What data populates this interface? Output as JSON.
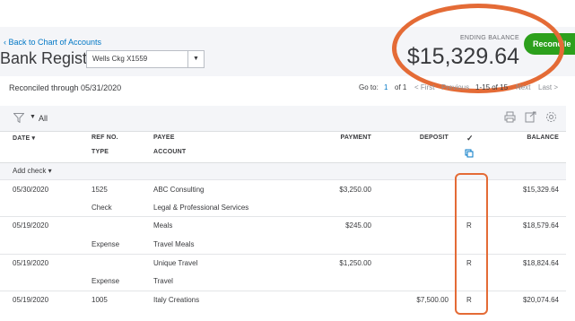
{
  "header": {
    "back_link": "Back to Chart of Accounts",
    "title": "Bank Register",
    "account_value": "Wells Ckg X1559",
    "ending_balance_label": "ENDING BALANCE",
    "ending_balance_value": "$15,329.64",
    "reconcile_label": "Reconcile"
  },
  "status": {
    "reconciled_through": "Reconciled through 05/31/2020"
  },
  "pager": {
    "go_to": "Go to:",
    "page": "1",
    "of": "of 1",
    "first": "< First",
    "previous": "Previous",
    "range": "1-15 of 15",
    "next": "Next",
    "last": "Last >"
  },
  "filter": {
    "label": "All"
  },
  "columns": {
    "date": "DATE ▾",
    "ref_no": "REF NO.",
    "type": "TYPE",
    "payee": "PAYEE",
    "account": "ACCOUNT",
    "payment": "PAYMENT",
    "deposit": "DEPOSIT",
    "check": "✓",
    "balance": "BALANCE"
  },
  "add_check": "Add check ▾",
  "rows": [
    {
      "date": "05/30/2020",
      "ref": "1525",
      "type": "Check",
      "payee": "ABC Consulting",
      "account": "Legal & Professional Services",
      "payment": "$3,250.00",
      "deposit": "",
      "status": "",
      "balance": "$15,329.64"
    },
    {
      "date": "05/19/2020",
      "ref": "",
      "type": "Expense",
      "payee": "Meals",
      "account": "Travel Meals",
      "payment": "$245.00",
      "deposit": "",
      "status": "R",
      "balance": "$18,579.64"
    },
    {
      "date": "05/19/2020",
      "ref": "",
      "type": "Expense",
      "payee": "Unique Travel",
      "account": "Travel",
      "payment": "$1,250.00",
      "deposit": "",
      "status": "R",
      "balance": "$18,824.64"
    },
    {
      "date": "05/19/2020",
      "ref": "1005",
      "type": "",
      "payee": "Italy Creations",
      "account": "",
      "payment": "",
      "deposit": "$7,500.00",
      "status": "R",
      "balance": "$20,074.64"
    }
  ],
  "colors": {
    "accent_green": "#2ca01c",
    "link_blue": "#0077c5",
    "annotation_orange": "#e46b36"
  }
}
